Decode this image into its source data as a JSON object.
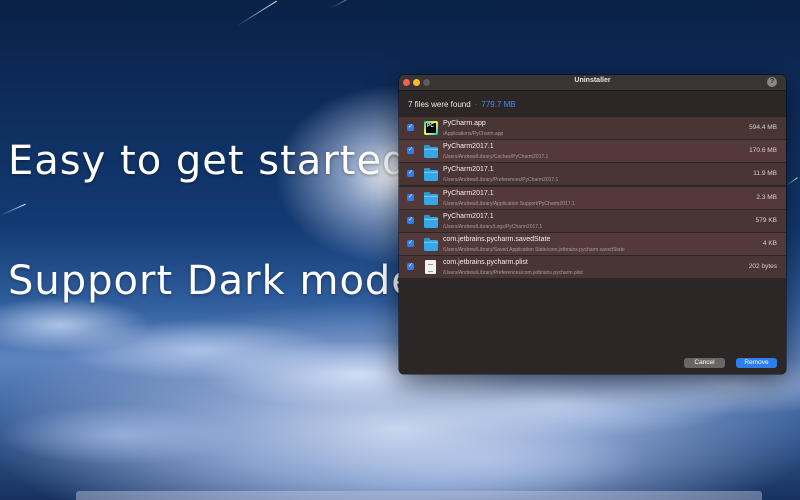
{
  "promo": {
    "line1": "Easy to get started",
    "line2": "Support Dark mode"
  },
  "window": {
    "title": "Uninstaller",
    "help_label": "?",
    "summary_count": "7 files were found",
    "summary_separator": "·",
    "summary_size": "779.7 MB",
    "cancel_label": "Cancel",
    "remove_label": "Remove"
  },
  "files": [
    {
      "name": "PyCharm.app",
      "path": "/Applications/PyCharm.app",
      "size": "594.4 MB",
      "icon": "pycharm-app-icon",
      "checked": true
    },
    {
      "name": "PyCharm2017.1",
      "path": "/Users/Andrew/Library/Caches/PyCharm2017.1",
      "size": "170.6 MB",
      "icon": "folder-icon",
      "checked": true
    },
    {
      "name": "PyCharm2017.1",
      "path": "/Users/Andrew/Library/Preferences/PyCharm2017.1",
      "size": "11.9 MB",
      "icon": "folder-icon",
      "checked": true
    },
    {
      "name": "PyCharm2017.1",
      "path": "/Users/Andrew/Library/Application Support/PyCharm2017.1",
      "size": "2.3 MB",
      "icon": "folder-icon",
      "checked": true
    },
    {
      "name": "PyCharm2017.1",
      "path": "/Users/Andrew/Library/Logs/PyCharm2017.1",
      "size": "579 KB",
      "icon": "folder-icon",
      "checked": true
    },
    {
      "name": "com.jetbrains.pycharm.savedState",
      "path": "/Users/Andrew/Library/Saved Application State/com.jetbrains.pycharm.savedState",
      "size": "4 KB",
      "icon": "folder-icon",
      "checked": true
    },
    {
      "name": "com.jetbrains.pycharm.plist",
      "path": "/Users/Andrew/Library/Preferences/com.jetbrains.pycharm.plist",
      "size": "202 bytes",
      "icon": "plist-file-icon",
      "checked": true
    }
  ],
  "colors": {
    "accent": "#2f7ef0",
    "window_bg": "#2d2626",
    "row_bg": "#4a3535",
    "close_light": "#fe5f57",
    "minimize_light": "#febb2e"
  }
}
